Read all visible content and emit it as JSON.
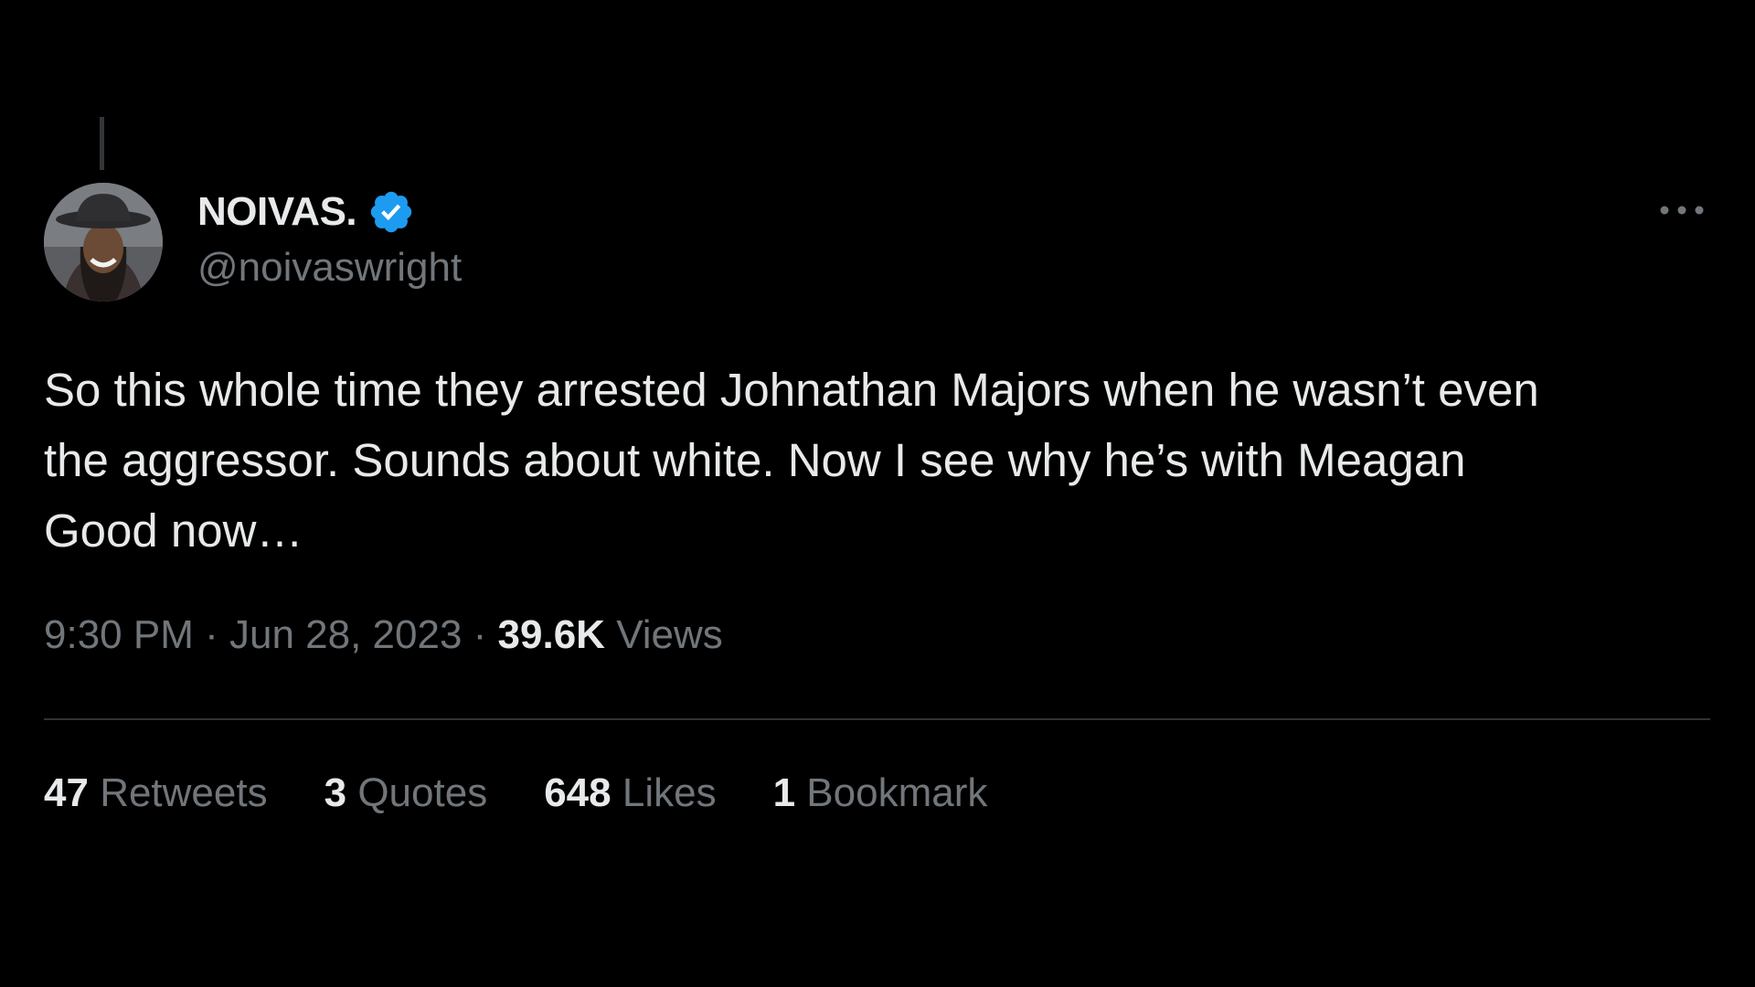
{
  "colors": {
    "background": "#000000",
    "primary_text": "#e7e9ea",
    "secondary_text": "#71767b",
    "verified_badge": "#1d9bf0",
    "divider": "#2f3336"
  },
  "author": {
    "display_name": "NOIVAS.",
    "handle": "@noivaswright",
    "verified": true,
    "verified_icon": "verified-badge-icon",
    "avatar_icon": "avatar-photo"
  },
  "tweet": {
    "text": "So this whole time they arrested Johnathan Majors when he wasn’t even\nthe aggressor. Sounds about white. Now I see why he’s with Meagan\nGood now…"
  },
  "meta": {
    "time": "9:30 PM",
    "separator": " · ",
    "date": "Jun 28, 2023",
    "views_count": "39.6K",
    "views_label": "Views"
  },
  "stats": {
    "retweets": {
      "count": "47",
      "label": "Retweets"
    },
    "quotes": {
      "count": "3",
      "label": "Quotes"
    },
    "likes": {
      "count": "648",
      "label": "Likes"
    },
    "bookmarks": {
      "count": "1",
      "label": "Bookmark"
    }
  },
  "more_icon": "more-horizontal-icon"
}
